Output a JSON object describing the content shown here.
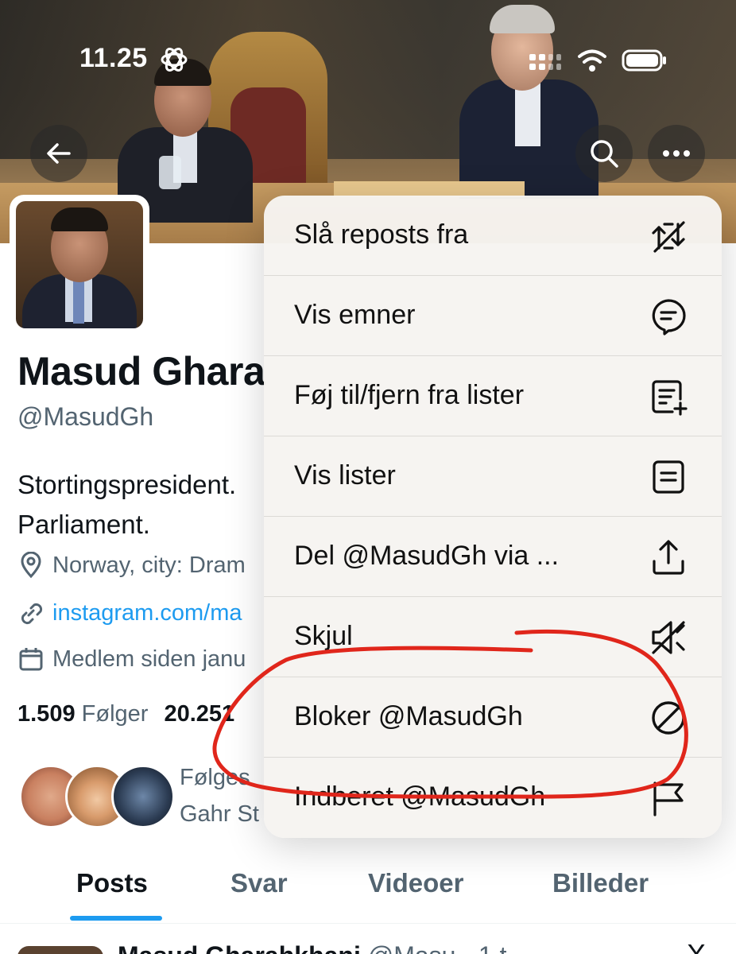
{
  "status_bar": {
    "time": "11.25"
  },
  "profile": {
    "name": "Masud Ghara",
    "handle": "@MasudGh",
    "bio_line1": "Stortingspresident.",
    "bio_line2": "Parliament.",
    "location": "Norway, city: Dram",
    "link": "instagram.com/ma",
    "joined": "Medlem siden janu",
    "following_count": "1.509",
    "following_label": "Følger",
    "followers_count": "20.251",
    "followed_by_line1": "Følges",
    "followed_by_line2": "Gahr St"
  },
  "tabs": [
    {
      "label": "Posts"
    },
    {
      "label": "Svar"
    },
    {
      "label": "Videoer"
    },
    {
      "label": "Billeder"
    }
  ],
  "post_preview": {
    "author": "Masud Gharahkhani",
    "handle": "@Masu",
    "time": "· 1 t",
    "close": "X"
  },
  "menu": {
    "items": [
      {
        "label": "Slå reposts fra",
        "icon": "repost-off-icon"
      },
      {
        "label": "Vis emner",
        "icon": "topics-icon"
      },
      {
        "label": "Føj til/fjern fra lister",
        "icon": "list-add-icon"
      },
      {
        "label": "Vis lister",
        "icon": "lists-icon"
      },
      {
        "label": "Del @MasudGh via ...",
        "icon": "share-icon"
      },
      {
        "label": "Skjul",
        "icon": "mute-icon"
      },
      {
        "label": "Bloker @MasudGh",
        "icon": "block-icon"
      },
      {
        "label": "Indberet @MasudGh",
        "icon": "flag-icon"
      }
    ]
  },
  "colors": {
    "accent": "#1d9bf0",
    "annotation": "#e0261b"
  }
}
